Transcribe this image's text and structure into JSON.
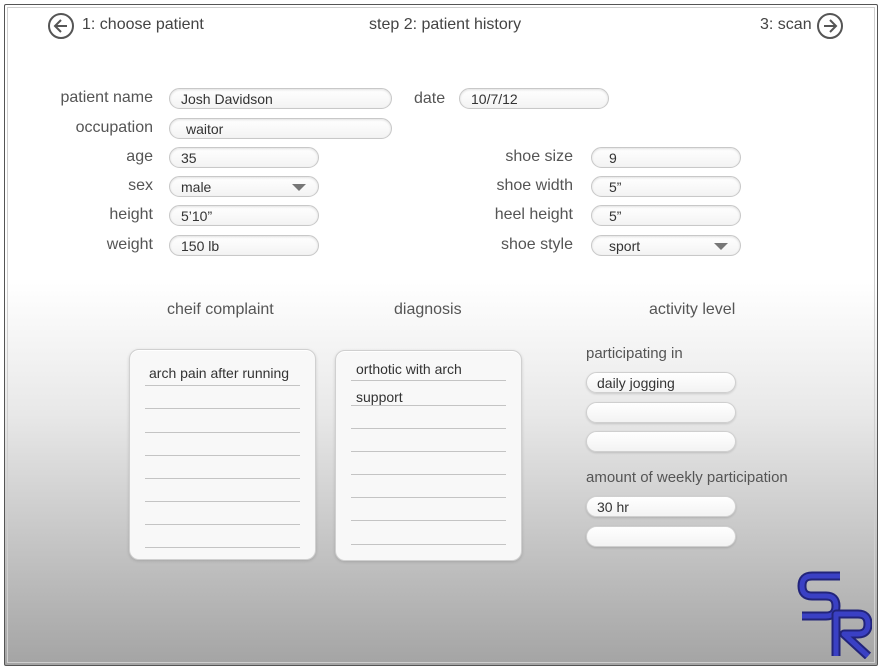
{
  "nav": {
    "back_label": "1: choose patient",
    "step_title": "step 2: patient history",
    "next_label": "3: scan"
  },
  "form": {
    "patient_name_label": "patient name",
    "patient_name_value": "Josh Davidson",
    "date_label": "date",
    "date_value": "10/7/12",
    "occupation_label": "occupation",
    "occupation_value": "waitor",
    "age_label": "age",
    "age_value": "35",
    "sex_label": "sex",
    "sex_value": "male",
    "height_label": "height",
    "height_value": "5’10”",
    "weight_label": "weight",
    "weight_value": "150 lb",
    "shoe_size_label": "shoe size",
    "shoe_size_value": "9",
    "shoe_width_label": "shoe width",
    "shoe_width_value": "5”",
    "heel_height_label": "heel height",
    "heel_height_value": "5”",
    "shoe_style_label": "shoe style",
    "shoe_style_value": "sport"
  },
  "sections": {
    "complaint_title": "cheif complaint",
    "diagnosis_title": "diagnosis",
    "activity_title": "activity level"
  },
  "complaint": {
    "lines": [
      "arch pain after running",
      "",
      "",
      "",
      "",
      "",
      "",
      ""
    ]
  },
  "diagnosis": {
    "lines": [
      "orthotic with arch",
      "support",
      "",
      "",
      "",
      "",
      "",
      ""
    ]
  },
  "activity": {
    "participating_label": "participating in",
    "participating": [
      "daily jogging",
      "",
      ""
    ],
    "weekly_label": "amount of weekly participation",
    "weekly": [
      "30 hr",
      ""
    ]
  },
  "logo": {
    "text": "SR",
    "color": "#2b2f9e"
  }
}
